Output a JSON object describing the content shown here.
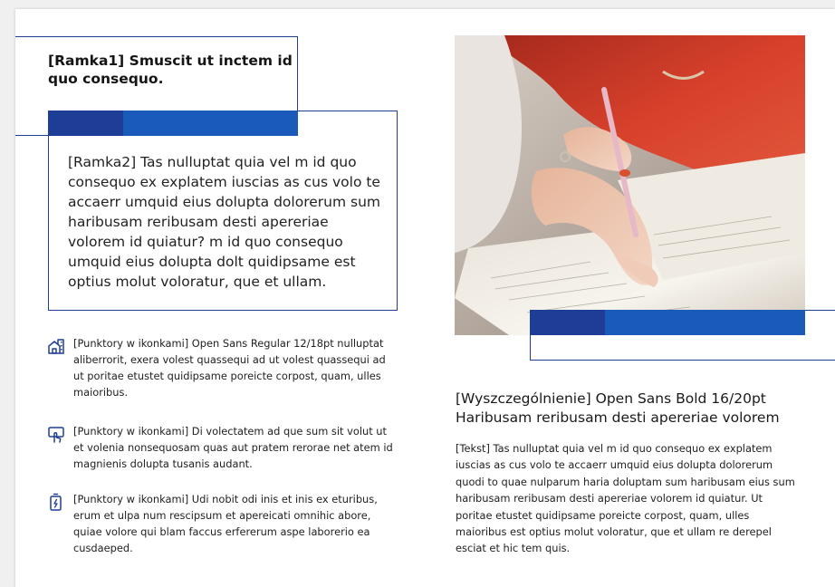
{
  "frame1": {
    "title": "[Ramka1] Smuscit ut inctem id quo consequo."
  },
  "frame2": {
    "text": "[Ramka2] Tas nulluptat quia vel m id quo consequo ex explatem iuscias as cus volo te accaerr umquid eius dolupta dolorerum sum haribusam reribusam desti apereriae volorem id quiatur? m id quo consequo umquid eius dolupta dolt quidipsame est optius molut voloratur, que et ullam."
  },
  "bullets": [
    {
      "icon": "house-icon",
      "text": "[Punktory w ikonkami] Open Sans Regular 12/18pt nulluptat aliberrorit, exera volest quassequi ad ut volest quassequi ad ut poritae etustet quidipsame poreicte corpost, quam, ulles maioribus."
    },
    {
      "icon": "hand-tap-icon",
      "text": "[Punktory w ikonkami] Di volectatem ad que sum sit volut ut et volenia nonsequosam quas aut pratem rerorae net atem id magnienis dolupta tusanis audant."
    },
    {
      "icon": "battery-charging-icon",
      "text": "[Punktory w ikonkami] Udi nobit odi inis et inis ex eturibus, erum et ulpa num rescipsum et apereicati omnihic abore, quiae volore qui blam faccus erfererum aspe laborerio ea cusdaeped."
    }
  ],
  "highlight": {
    "text": "[Wyszczególnienie] Open Sans Bold 16/20pt Haribusam reribusam desti apereriae volorem"
  },
  "body": {
    "text": "[Tekst] Tas nulluptat quia vel m id quo consequo ex explatem iuscias as cus volo te accaerr umquid eius dolupta dolorerum quodi to quae nulparum haria doluptam sum haribusam eius sum haribusam reribusam desti apereriae volorem id quiatur. Ut poritae etustet quidipsame poreicte corpost, quam, ulles maioribus est optius molut voloratur, que et ullam re derepel esciat et hic tem quis."
  },
  "colors": {
    "frame_line": "#1f3f97",
    "bar_dark": "#1e3d96",
    "bar_light": "#1a5ab8",
    "icon": "#1f3f97"
  }
}
